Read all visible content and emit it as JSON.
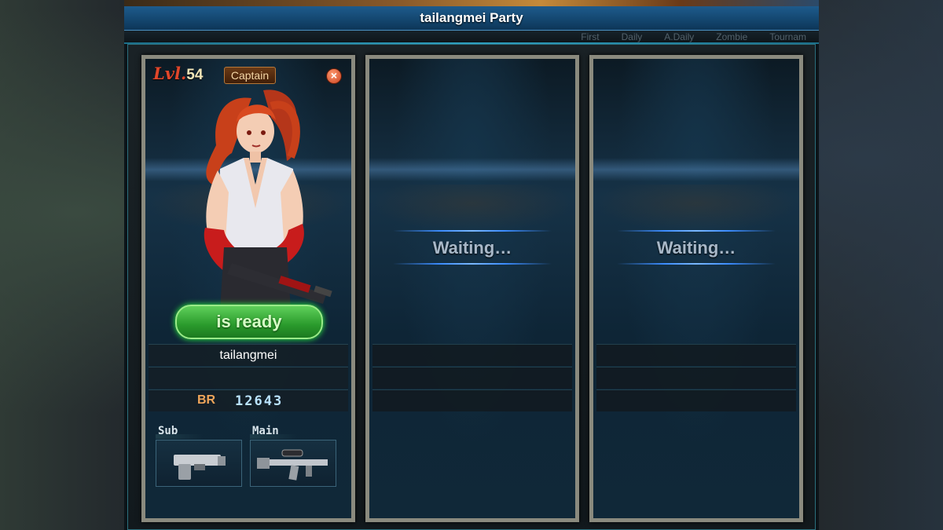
{
  "window": {
    "title": "tailangmei Party",
    "filters": [
      "First",
      "Daily",
      "A.Daily",
      "Zombie",
      "Tournam"
    ]
  },
  "slots": [
    {
      "level_prefix": "Lvl.",
      "level": "54",
      "role": "Captain",
      "status": "is ready",
      "name": "tailangmei",
      "br_label": "BR",
      "br_value": "12643",
      "sub_label": "Sub",
      "main_label": "Main"
    },
    {
      "status": "Waiting…"
    },
    {
      "status": "Waiting…"
    }
  ],
  "colors": {
    "title_bar": "#1e5b8c",
    "ready_green": "#2a9a2c",
    "level_red": "#e0462a",
    "captain_bg": "#6a3a16"
  }
}
